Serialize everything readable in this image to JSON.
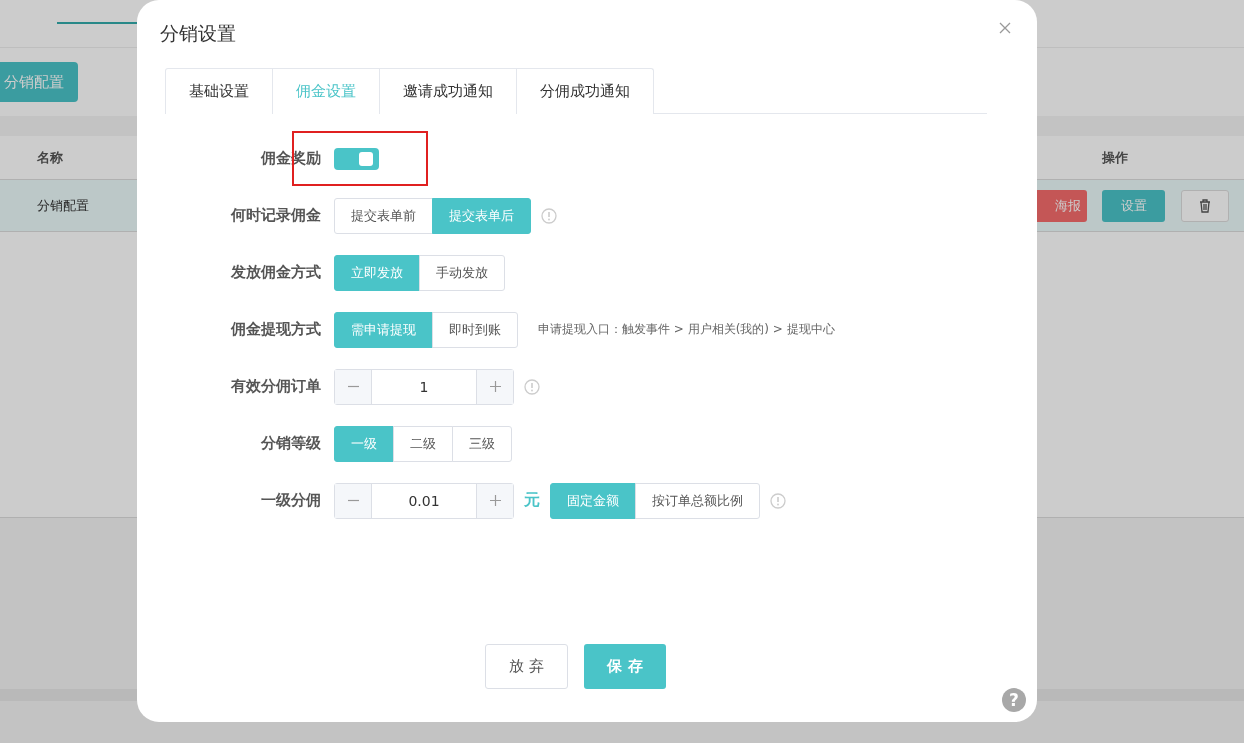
{
  "background": {
    "add_button": "分销配置",
    "columns": [
      "名称",
      "操作"
    ],
    "rows": [
      {
        "name": "分销配置",
        "poster_button": "海报",
        "settings_button": "设置"
      }
    ]
  },
  "dialog": {
    "title": "分销设置",
    "tabs": [
      {
        "label": "基础设置",
        "selected": false
      },
      {
        "label": "佣金设置",
        "selected": true
      },
      {
        "label": "邀请成功通知",
        "selected": false
      },
      {
        "label": "分佣成功通知",
        "selected": false
      }
    ],
    "fields": [
      {
        "kind": "switch",
        "label": "佣金奖励",
        "on": true,
        "highlighted": true
      },
      {
        "kind": "options",
        "label": "何时记录佣金",
        "options": [
          {
            "label": "提交表单前",
            "selected": false
          },
          {
            "label": "提交表单后",
            "selected": true
          }
        ],
        "info": true
      },
      {
        "kind": "options",
        "label": "发放佣金方式",
        "options": [
          {
            "label": "立即发放",
            "selected": true
          },
          {
            "label": "手动发放",
            "selected": false
          }
        ]
      },
      {
        "kind": "options",
        "label": "佣金提现方式",
        "options": [
          {
            "label": "需申请提现",
            "selected": true
          },
          {
            "label": "即时到账",
            "selected": false
          }
        ],
        "note": "申请提现入口：触发事件 > 用户相关(我的) > 提现中心"
      },
      {
        "kind": "stepper",
        "label": "有效分佣订单",
        "value": "1",
        "info": true
      },
      {
        "kind": "options",
        "label": "分销等级",
        "options": [
          {
            "label": "一级",
            "selected": true
          },
          {
            "label": "二级",
            "selected": false
          },
          {
            "label": "三级",
            "selected": false
          }
        ]
      },
      {
        "kind": "stepper",
        "label": "一级分佣",
        "value": "0.01",
        "unit": "元",
        "options": [
          {
            "label": "固定金额",
            "selected": true
          },
          {
            "label": "按订单总额比例",
            "selected": false
          }
        ],
        "info": true
      }
    ],
    "cancel_button": "放 弃",
    "save_button": "保 存",
    "help": "?"
  }
}
